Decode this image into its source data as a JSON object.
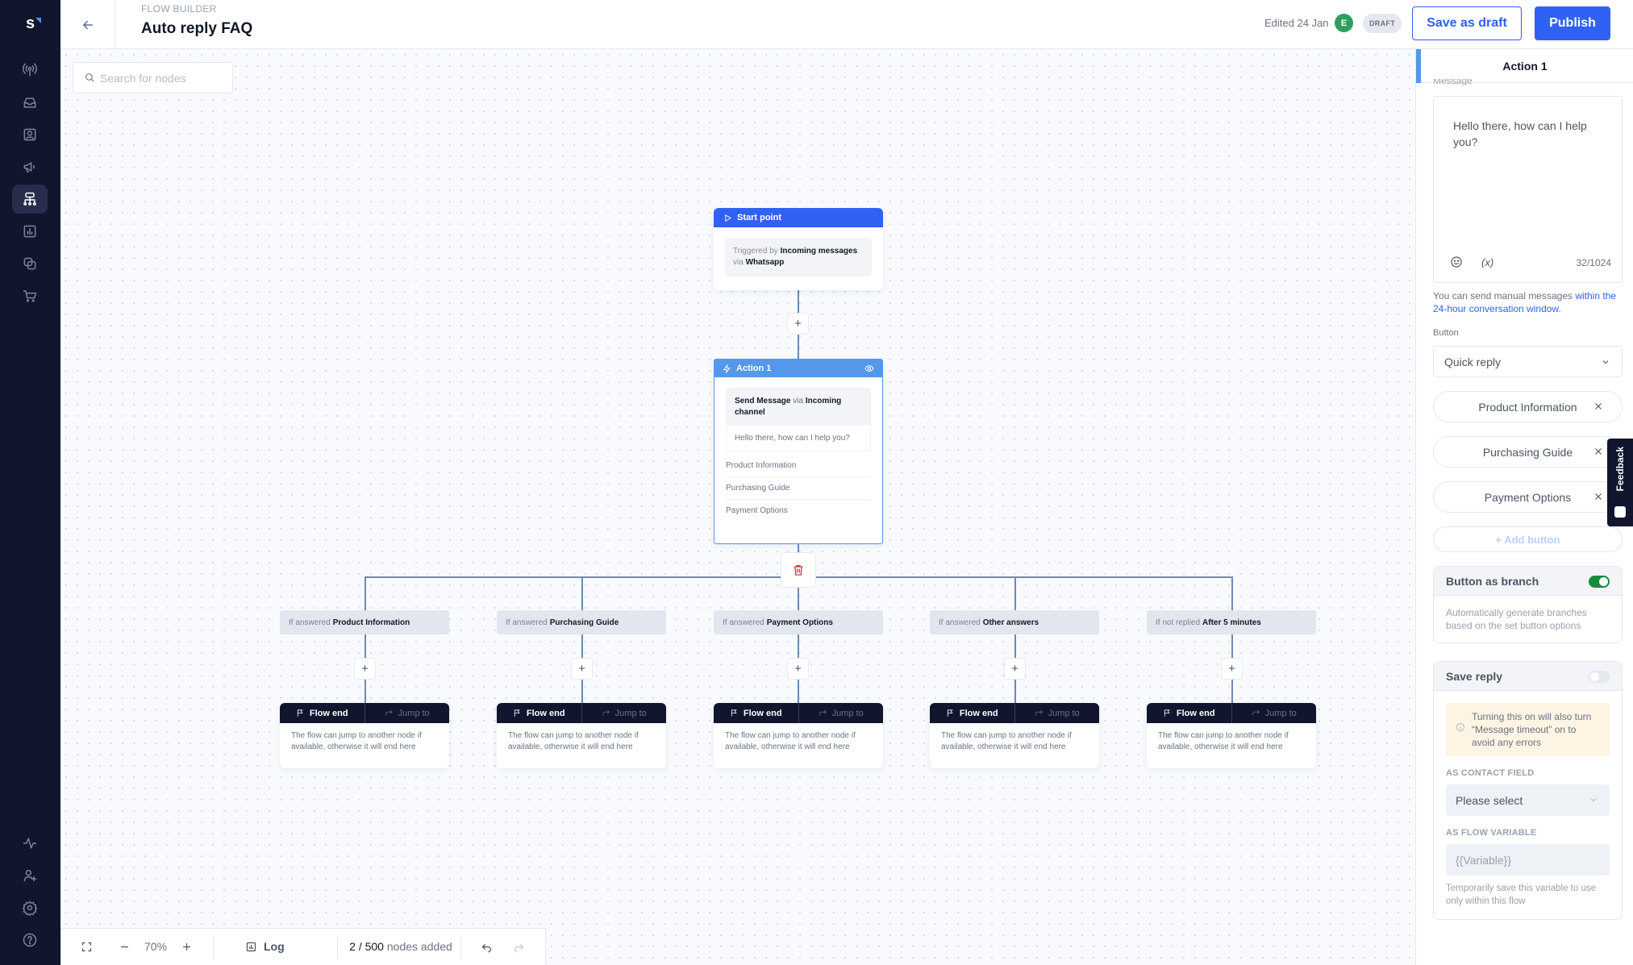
{
  "app": {
    "logo": "s"
  },
  "sidebar": {
    "items": [
      {
        "icon": "broadcast-icon",
        "active": false
      },
      {
        "icon": "inbox-icon",
        "active": false
      },
      {
        "icon": "contacts-icon",
        "active": false
      },
      {
        "icon": "megaphone-icon",
        "active": false
      },
      {
        "icon": "flow-builder-icon",
        "active": true
      },
      {
        "icon": "reports-icon",
        "active": false
      },
      {
        "icon": "integrations-icon",
        "active": false
      },
      {
        "icon": "cart-icon",
        "active": false
      }
    ],
    "bottom_items": [
      {
        "icon": "activity-icon"
      },
      {
        "icon": "add-user-icon"
      },
      {
        "icon": "settings-icon"
      },
      {
        "icon": "help-icon"
      }
    ]
  },
  "header": {
    "breadcrumb": "FLOW BUILDER",
    "title": "Auto reply FAQ",
    "edited": "Edited 24 Jan",
    "avatar_initial": "E",
    "status_badge": "DRAFT",
    "save_draft_label": "Save as draft",
    "publish_label": "Publish"
  },
  "canvas": {
    "search_placeholder": "Search for nodes",
    "start_node": {
      "title": "Start point",
      "triggered_prefix": "Triggered by",
      "trigger": "Incoming messages",
      "via_prefix": "via",
      "channel": "Whatsapp"
    },
    "action_node": {
      "title": "Action 1",
      "action": "Send Message",
      "via": "via",
      "channel": "Incoming channel",
      "message": "Hello there, how can I help you?",
      "buttons": [
        "Product Information",
        "Purchasing Guide",
        "Payment Options"
      ]
    },
    "branches": [
      {
        "prefix": "If answered",
        "value": "Product Information"
      },
      {
        "prefix": "If answered",
        "value": "Purchasing Guide"
      },
      {
        "prefix": "If answered",
        "value": "Payment Options"
      },
      {
        "prefix": "If answered",
        "value": "Other answers"
      },
      {
        "prefix": "If not replied",
        "value": "After 5 minutes"
      }
    ],
    "flow_end": {
      "flow_end_label": "Flow end",
      "jump_label": "Jump to",
      "description": "The flow can jump to another node if available, otherwise it will end here"
    },
    "bottombar": {
      "zoom": "70%",
      "log_label": "Log",
      "nodes_count": "2 / 500",
      "nodes_suffix": "nodes added"
    }
  },
  "panel": {
    "title": "Action 1",
    "message_label": "Message",
    "message_value": "Hello there, how can I help you?",
    "variable_button": "(x)",
    "char_count": "32/1024",
    "hint_prefix": "You can send manual messages ",
    "hint_link": "within the 24-hour conversation window.",
    "button_label": "Button",
    "button_type": "Quick reply",
    "buttons": [
      "Product Information",
      "Purchasing Guide",
      "Payment Options"
    ],
    "add_button": "+ Add button",
    "button_as_branch": {
      "title": "Button as branch",
      "enabled": true,
      "description": "Automatically generate branches based on the set button options"
    },
    "save_reply": {
      "title": "Save reply",
      "enabled": false,
      "warning": "Turning this on will also turn “Message timeout” on to avoid any errors",
      "contact_field_label": "AS CONTACT FIELD",
      "contact_field_value": "Please select",
      "flow_variable_label": "AS FLOW VARIABLE",
      "flow_variable_placeholder": "{{Variable}}",
      "flow_variable_hint": "Temporarily save this variable to use only within this flow"
    }
  },
  "feedback_label": "Feedback"
}
